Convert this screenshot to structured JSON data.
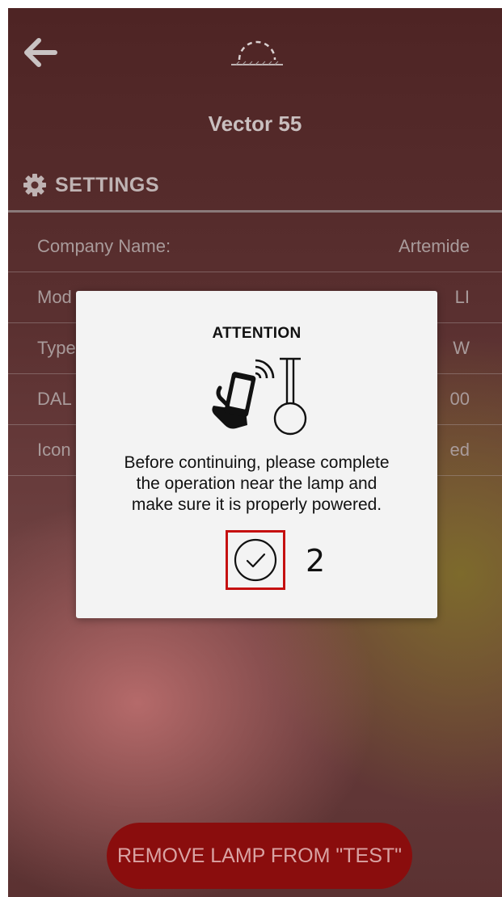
{
  "header": {
    "back_icon": "arrow-left-icon",
    "lamp_icon": "ceiling-lamp-icon",
    "title": "Vector 55"
  },
  "settings": {
    "icon": "gear-icon",
    "label": "SETTINGS",
    "rows": [
      {
        "label": "Company Name:",
        "value": "Artemide"
      },
      {
        "label": "Mod",
        "value": "LI"
      },
      {
        "label": "Type",
        "value": "W"
      },
      {
        "label": "DAL",
        "value": "00"
      },
      {
        "label": "Icon",
        "value": "ed"
      }
    ]
  },
  "footer": {
    "remove_button_label": "REMOVE LAMP FROM \"TEST\""
  },
  "dialog": {
    "title": "ATTENTION",
    "illustration": "phone-near-lamp-icon",
    "message_lines": [
      "Before continuing, please complete",
      "the operation near the lamp and",
      "make sure it is properly powered."
    ],
    "confirm_icon": "check-circle-icon",
    "annotation_number": "2"
  },
  "colors": {
    "annotation_box": "#c51010",
    "remove_button": "#8a0d0d",
    "dialog_bg": "#f3f3f3"
  }
}
